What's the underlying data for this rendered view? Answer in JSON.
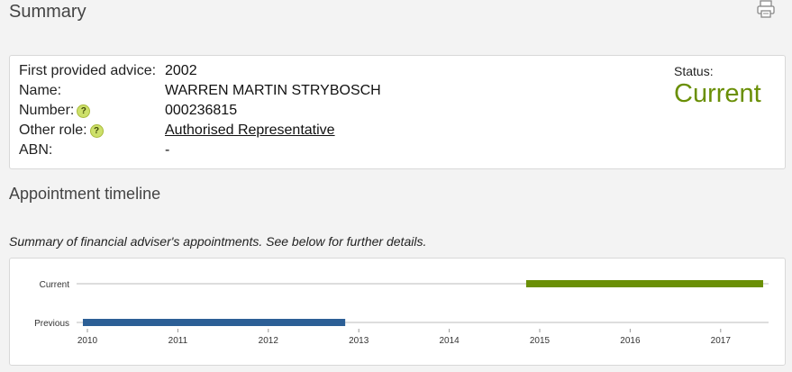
{
  "page": {
    "title": "Summary"
  },
  "icons": {
    "print": "print-icon",
    "help": "question-mark-help-icon"
  },
  "summary": {
    "fields": [
      {
        "label": "First provided advice:",
        "value": "2002"
      },
      {
        "label": "Name:",
        "value": "WARREN MARTIN STRYBOSCH"
      },
      {
        "label": "Number:",
        "value": "000236815",
        "help": "?"
      },
      {
        "label": "Other role:",
        "value": "Authorised Representative",
        "help": "?"
      },
      {
        "label": "ABN:",
        "value": "-"
      }
    ],
    "status_label": "Status:",
    "status_value": "Current"
  },
  "timeline": {
    "heading": "Appointment timeline",
    "caption": "Summary of financial adviser's appointments. See below for further details."
  },
  "colors": {
    "current": "#6a8f06",
    "previous": "#2c5f96",
    "status": "#6a8f06"
  },
  "chart_data": {
    "type": "bar",
    "orientation": "horizontal-gantt",
    "categories": [
      "Current",
      "Previous"
    ],
    "xlim": [
      2010,
      2017.5
    ],
    "x_ticks": [
      "2010",
      "2011",
      "2012",
      "2013",
      "2014",
      "2015",
      "2016",
      "2017"
    ],
    "series": [
      {
        "category": "Current",
        "start": 2014.85,
        "end": 2017.47,
        "color": "#6a8f06"
      },
      {
        "category": "Previous",
        "start": 2009.95,
        "end": 2012.85,
        "color": "#2c5f96"
      }
    ],
    "grid": false
  }
}
